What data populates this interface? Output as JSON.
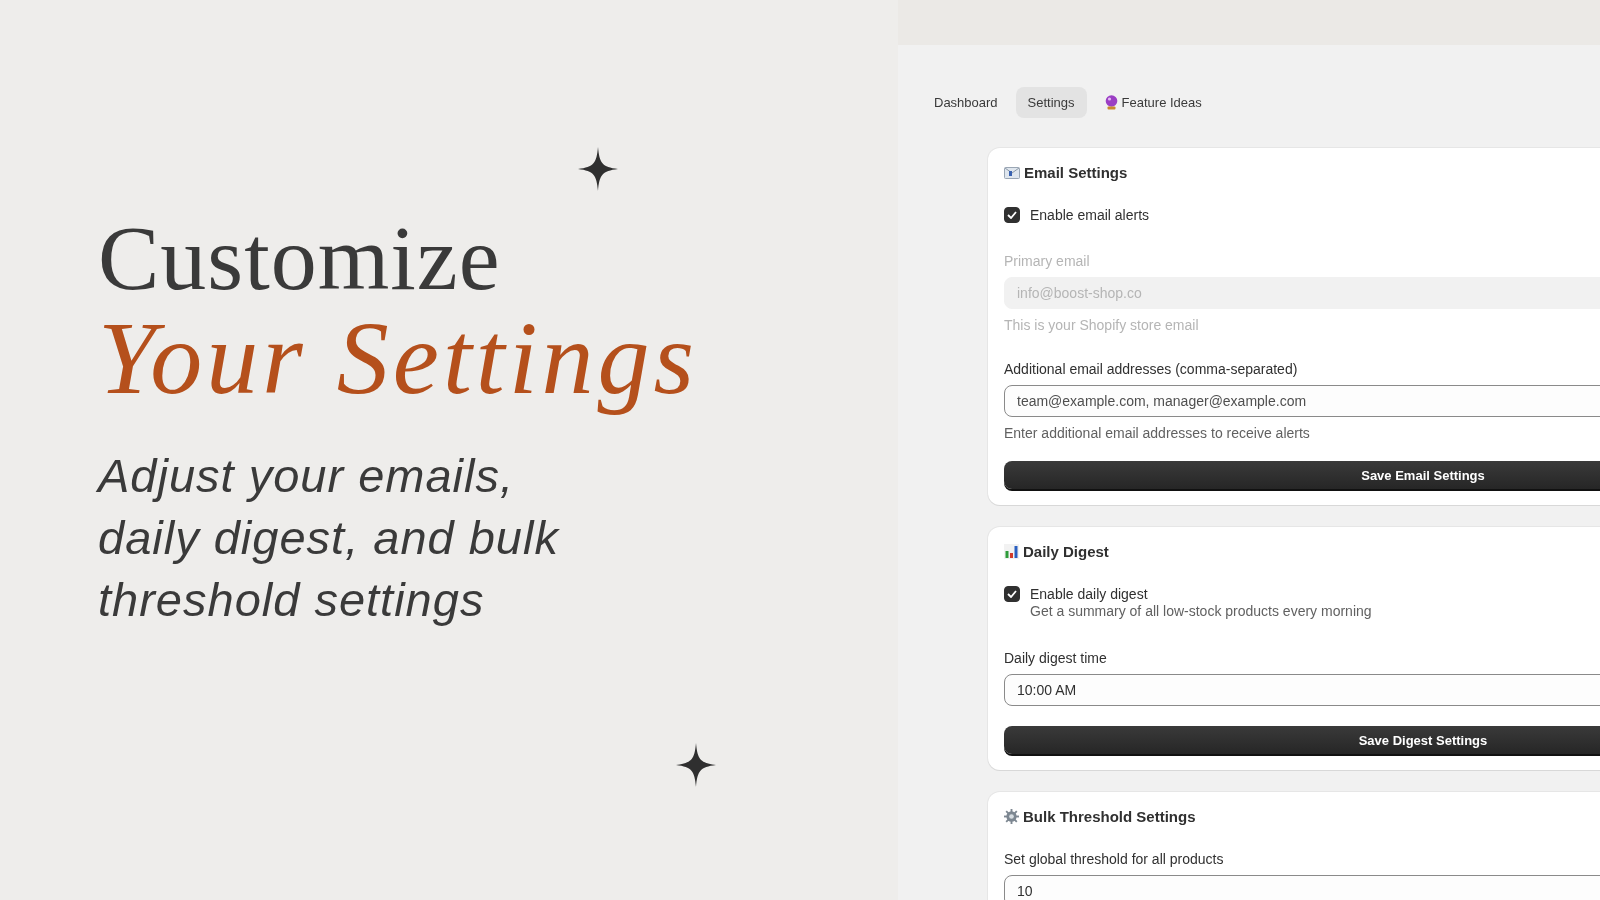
{
  "hero": {
    "title": "Customize",
    "title_accent": "Your Settings",
    "subtitle_lines": [
      "Adjust your emails,",
      "daily digest, and bulk",
      "threshold settings"
    ]
  },
  "tabs": [
    {
      "label": "Dashboard",
      "selected": false
    },
    {
      "label": "Settings",
      "selected": true
    },
    {
      "label": "Feature Ideas",
      "selected": false
    }
  ],
  "sections": [
    {
      "title": "Email Settings",
      "fields": [
        {
          "kind": "checkbox",
          "label": "Enable email alerts",
          "checked": true
        },
        {
          "kind": "text",
          "label": "Primary email",
          "value": "info@boost-shop.co",
          "disabled": true,
          "help": "This is your Shopify store email"
        },
        {
          "kind": "text",
          "label": "Additional email addresses (comma-separated)",
          "placeholder": "team@example.com, manager@example.com",
          "disabled": false,
          "help": "Enter additional email addresses to receive alerts"
        }
      ],
      "button": "Save Email Settings"
    },
    {
      "title": "Daily Digest",
      "fields": [
        {
          "kind": "checkbox",
          "label": "Enable daily digest",
          "checked": true,
          "help": "Get a summary of all low-stock products every morning"
        },
        {
          "kind": "text",
          "label": "Daily digest time",
          "value": "10:00 AM",
          "disabled": false
        }
      ],
      "button": "Save Digest Settings"
    },
    {
      "title": "Bulk Threshold Settings",
      "fields": [
        {
          "kind": "text",
          "label": "Set global threshold for all products",
          "value": "10",
          "disabled": false
        }
      ]
    }
  ]
}
